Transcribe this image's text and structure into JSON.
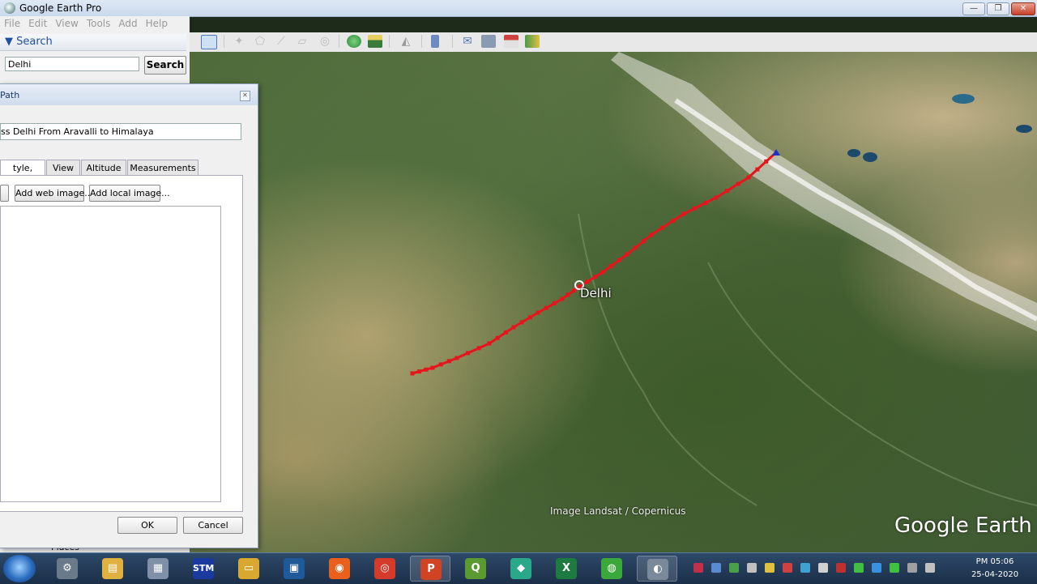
{
  "window": {
    "title": "Google Earth Pro"
  },
  "menu": {
    "items": [
      "File",
      "Edit",
      "View",
      "Tools",
      "Add",
      "Help"
    ]
  },
  "search": {
    "header": "▼ Search",
    "query": "Delhi",
    "button": "Search"
  },
  "toolbar": {
    "icons": [
      "sidebar-toggle-icon",
      "placemark-icon",
      "polygon-icon",
      "path-icon",
      "image-overlay-icon",
      "record-tour-icon",
      "historical-imagery-icon",
      "sunlight-icon",
      "planets-icon",
      "ruler-icon",
      "email-icon",
      "print-icon",
      "save-image-icon",
      "view-in-maps-icon"
    ]
  },
  "dialog": {
    "title": "Path",
    "name_value": "ss Delhi From Aravalli to Himalaya",
    "tabs": [
      "tyle, Color",
      "View",
      "Altitude",
      "Measurements"
    ],
    "add_web_image": "Add web image...",
    "add_local_image": "Add local image...",
    "ok": "OK",
    "cancel": "Cancel"
  },
  "places": {
    "label": "Places"
  },
  "map": {
    "place_label": "Delhi",
    "attribution": "Image Landsat / Copernicus",
    "logo": "Google Earth",
    "path_color": "#e8141c"
  },
  "taskbar": {
    "apps": [
      {
        "name": "control-panel",
        "glyph": "⚙",
        "color": "#6a7a8a",
        "active": false
      },
      {
        "name": "folder",
        "glyph": "▤",
        "color": "#e0b040",
        "active": false
      },
      {
        "name": "calculator",
        "glyph": "▦",
        "color": "#8090a8",
        "active": false
      },
      {
        "name": "stm-app",
        "glyph": "STM",
        "color": "#1a3aa0",
        "active": false
      },
      {
        "name": "file-explorer",
        "glyph": "▭",
        "color": "#d8a830",
        "active": false
      },
      {
        "name": "media-app",
        "glyph": "▣",
        "color": "#1e5a9a",
        "active": false
      },
      {
        "name": "firefox",
        "glyph": "◉",
        "color": "#e8601c",
        "active": false
      },
      {
        "name": "chrome",
        "glyph": "◎",
        "color": "#d63a2a",
        "active": false
      },
      {
        "name": "powerpoint",
        "glyph": "P",
        "color": "#d04424",
        "active": true
      },
      {
        "name": "qgis",
        "glyph": "Q",
        "color": "#5a9a30",
        "active": false
      },
      {
        "name": "filmora",
        "glyph": "◆",
        "color": "#2aa88a",
        "active": false
      },
      {
        "name": "excel",
        "glyph": "X",
        "color": "#1d7a40",
        "active": false
      },
      {
        "name": "green-app",
        "glyph": "◍",
        "color": "#3aa83a",
        "active": false
      },
      {
        "name": "google-earth-pro",
        "glyph": "◐",
        "color": "#7a8a9a",
        "active": true
      }
    ],
    "tray_colors": [
      "#c0304a",
      "#5a8ad0",
      "#4aa04a",
      "#c0c0c0",
      "#e0c040",
      "#d04040",
      "#40a0d0",
      "#d0d0d0",
      "#c03030",
      "#40c040",
      "#3a90e0",
      "#40c040",
      "#a0a0a0",
      "#c0c0c0"
    ],
    "time": "PM 05:06",
    "date": "25-04-2020"
  }
}
